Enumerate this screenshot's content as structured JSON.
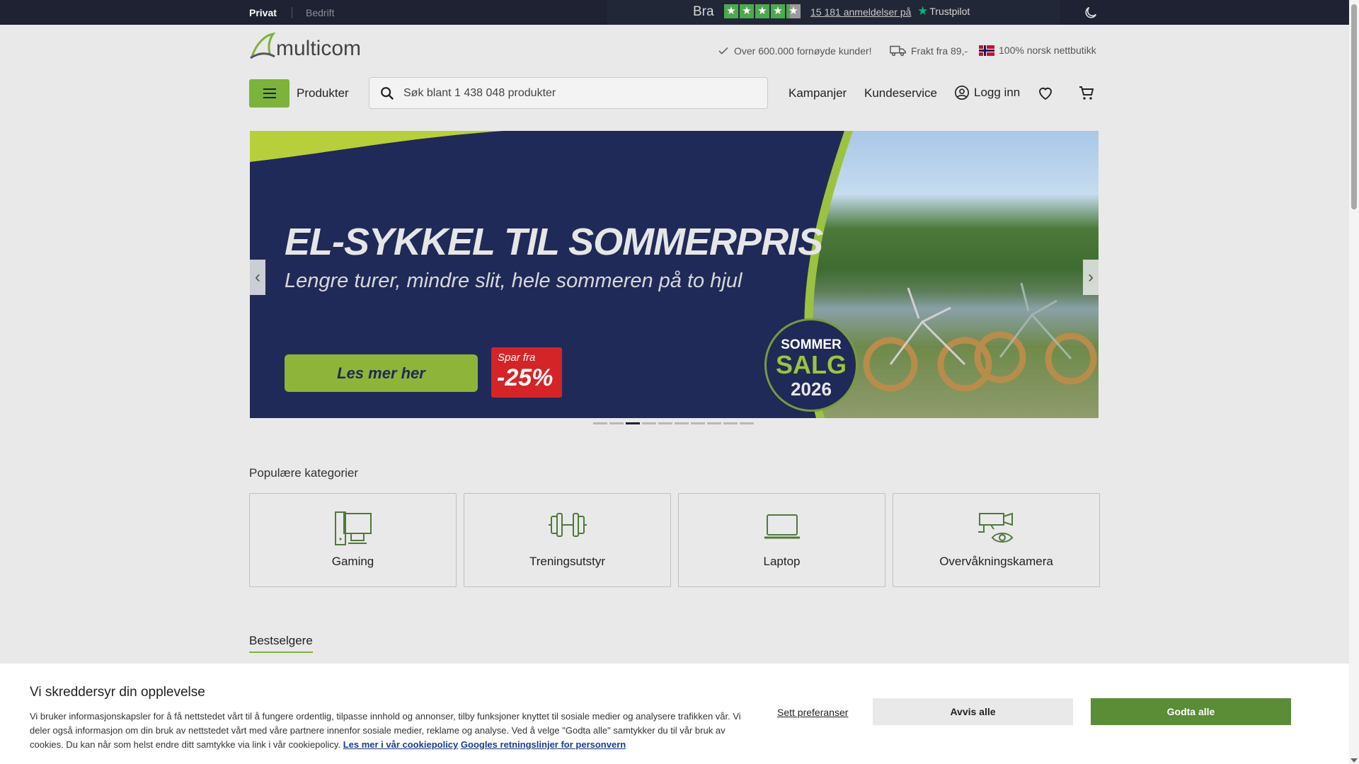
{
  "topbar": {
    "segments": {
      "private": "Privat",
      "business": "Bedrift"
    },
    "trustpilot": {
      "rating_word": "Bra",
      "stars": 4.5,
      "reviews_link": "15 181 anmeldelser på",
      "brand": "Trustpilot",
      "star_glyph": "★"
    },
    "dark_mode_icon": "moon-icon"
  },
  "header": {
    "logo_text": "multicom",
    "usps": [
      {
        "icon": "check-icon",
        "text": "Over 600.000 fornøyde kunder!"
      },
      {
        "icon": "truck-icon",
        "text": "Frakt fra 89,-"
      },
      {
        "icon": "norway-flag-icon",
        "text": "100% norsk nettbutikk"
      }
    ]
  },
  "nav": {
    "menu_label": "Produkter",
    "search_placeholder": "Søk blant 1 438 048 produkter",
    "links": {
      "campaigns": "Kampanjer",
      "support": "Kundeservice",
      "login": "Logg inn"
    }
  },
  "banner": {
    "title": "EL-SYKKEL TIL SOMMERPRIS",
    "subtitle": "Lengre turer, mindre slit, hele sommeren på to hjul",
    "button": "Les mer her",
    "save_label": "Spar fra",
    "save_value": "-25%",
    "badge": {
      "line1": "SOMMER",
      "line2": "SALG",
      "line3": "2026"
    },
    "prev_arrow": "‹",
    "next_arrow": "›",
    "slides": 10,
    "active_slide": 3
  },
  "categories": {
    "title": "Populære kategorier",
    "items": [
      {
        "label": "Gaming",
        "icon": "desktop-computer-icon"
      },
      {
        "label": "Treningsutstyr",
        "icon": "dumbbell-icon"
      },
      {
        "label": "Laptop",
        "icon": "laptop-icon"
      },
      {
        "label": "Overvåkningskamera",
        "icon": "security-camera-icon"
      }
    ]
  },
  "bestsellers": {
    "tab": "Bestselgere"
  },
  "cookie": {
    "title": "Vi skreddersyr din opplevelse",
    "text": "Vi bruker informasjonskapsler for å få nettstedet vårt til å fungere ordentlig, tilpasse innhold og annonser, tilby funksjoner knyttet til sosiale medier og analysere trafikken vår. Vi deler også informasjon om din bruk av nettstedet vårt med våre partnere innenfor sosiale medier, reklame og analyse. Ved å velge \"Godta alle\" samtykker du til vår bruk av cookies. Du kan når som helst endre ditt samtykke via link i vår cookiepolicy.",
    "link_policy": "Les mer i vår cookiepolicy",
    "link_google": "Googles retningslinjer for personvern",
    "preferences": "Sett preferanser",
    "reject": "Avvis alle",
    "accept": "Godta alle"
  }
}
